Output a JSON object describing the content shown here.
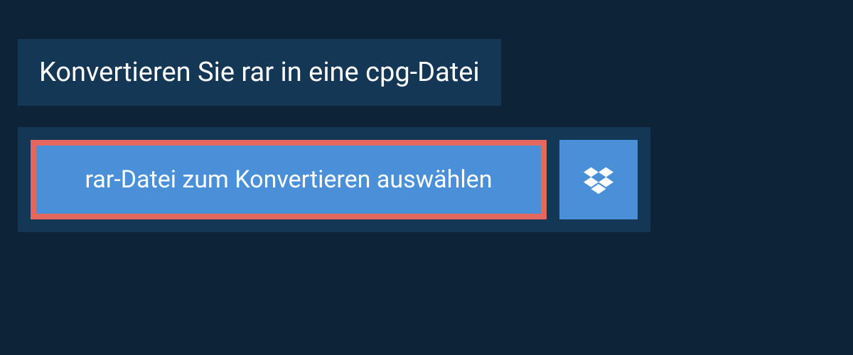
{
  "header": {
    "title": "Konvertieren Sie rar in eine cpg-Datei"
  },
  "actions": {
    "select_file_label": "rar-Datei zum Konvertieren auswählen"
  },
  "colors": {
    "page_bg": "#0d2438",
    "panel_bg": "#143755",
    "button_bg": "#4a90d9",
    "button_border": "#e4685d",
    "text": "#ffffff"
  }
}
